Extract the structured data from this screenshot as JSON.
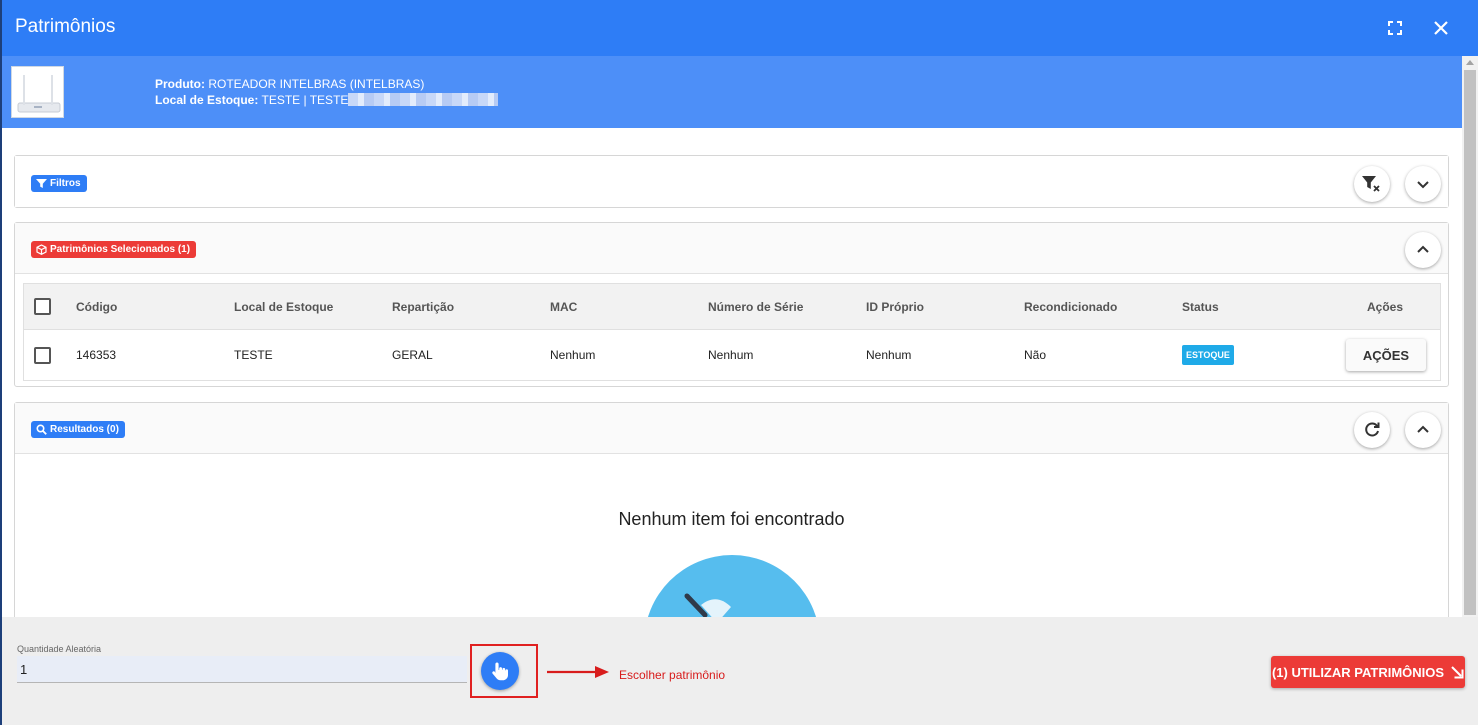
{
  "window": {
    "title": "Patrimônios"
  },
  "product": {
    "produto_label": "Produto:",
    "produto_value": "ROTEADOR INTELBRAS (INTELBRAS)",
    "local_label": "Local de Estoque:",
    "local_value": "TESTE | TESTE"
  },
  "filters": {
    "chip_label": "Filtros"
  },
  "selected": {
    "chip_label": "Patrimônios Selecionados (1)",
    "columns": [
      "Código",
      "Local de Estoque",
      "Repartição",
      "MAC",
      "Número de Série",
      "ID Próprio",
      "Recondicionado",
      "Status",
      "Ações"
    ],
    "rows": [
      {
        "codigo": "146353",
        "local": "TESTE",
        "reparticao": "GERAL",
        "mac": "Nenhum",
        "numero_serie": "Nenhum",
        "id_proprio": "Nenhum",
        "recondicionado": "Não",
        "status": "ESTOQUE",
        "acoes": "AÇÕES"
      }
    ]
  },
  "results": {
    "chip_label": "Resultados (0)",
    "empty_text": "Nenhum item foi encontrado"
  },
  "footer": {
    "qty_label": "Quantidade Aleatória",
    "qty_value": "1",
    "annotation": "Escolher patrimônio",
    "use_button": "(1) UTILIZAR PATRIMÔNIOS"
  },
  "colors": {
    "primary": "#2e7df6",
    "danger": "#ec3b37",
    "status": "#1faae8",
    "annotation": "#d81c1c"
  },
  "icons": [
    "fullscreen-icon",
    "close-icon",
    "filter-icon",
    "filter-clear-icon",
    "chevron-down-icon",
    "chevron-up-icon",
    "cube-icon",
    "search-icon",
    "refresh-icon",
    "hand-pointer-icon",
    "arrow-down-right-icon"
  ]
}
